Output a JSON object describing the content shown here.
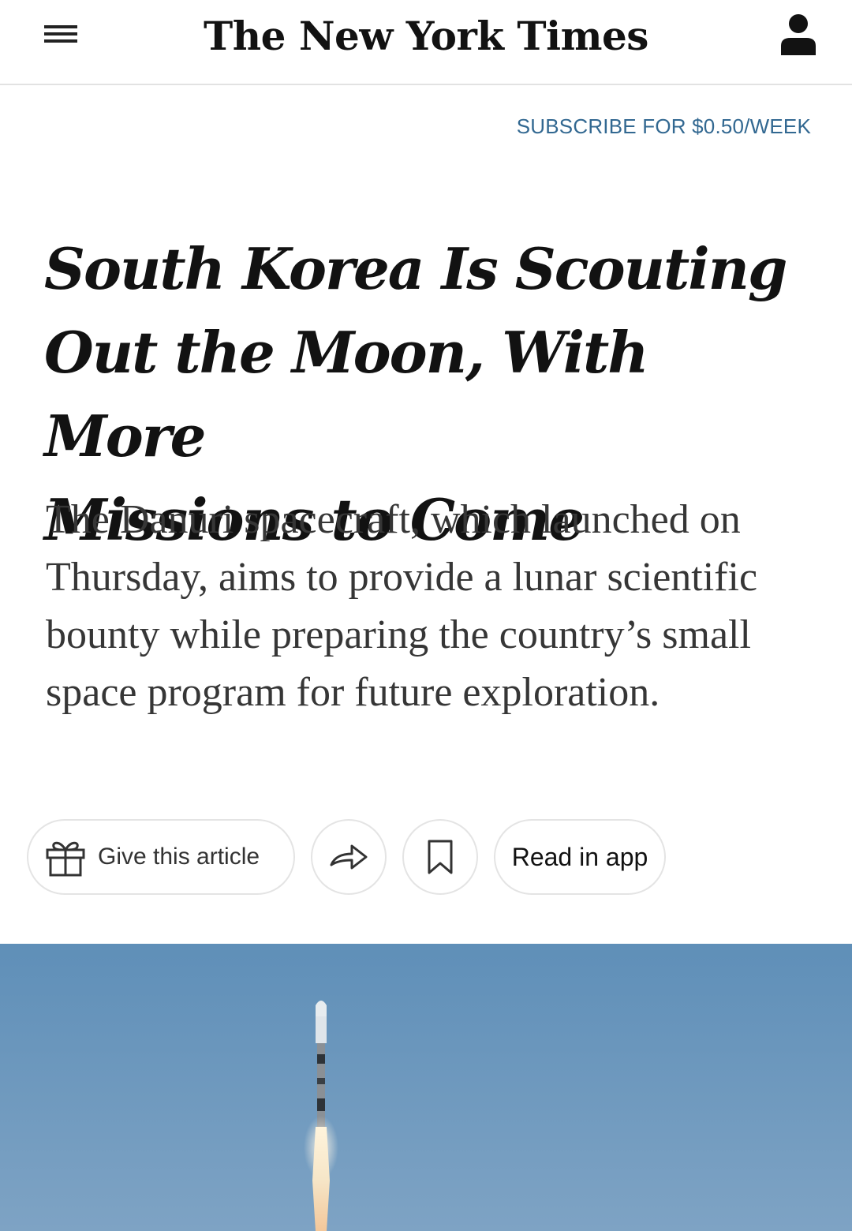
{
  "header": {
    "logo_text": "The New York Times",
    "menu_icon": "hamburger-menu-icon",
    "account_icon": "user-account-icon"
  },
  "subscribe": {
    "label": "SUBSCRIBE FOR $0.50/WEEK"
  },
  "article": {
    "headline_lines": [
      "South Korea Is Scouting",
      "Out the Moon, With More",
      "Missions to Come"
    ],
    "summary": "The Danuri spacecraft, which launched on Thursday, aims to provide a lunar scientific bounty while preparing the country’s small space program for future exploration."
  },
  "tools": {
    "gift_label": "Give this article",
    "gift_icon": "gift-icon",
    "share_icon": "share-arrow-icon",
    "save_icon": "bookmark-icon",
    "app_label": "Read in app"
  },
  "lead_image": {
    "subject": "rocket-launch-photo"
  },
  "colors": {
    "link": "#326891",
    "text": "#121212",
    "summary_text": "#363636",
    "divider": "#e2e2e2",
    "sky_top": "#5f8fb8",
    "sky_bottom": "#7ea3c4"
  }
}
